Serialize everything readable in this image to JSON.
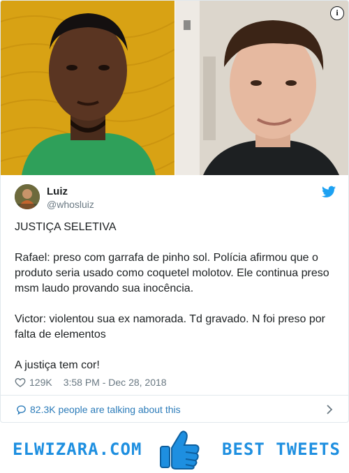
{
  "media": {
    "left_photo_icon": "portrait-photo",
    "right_photo_icon": "portrait-photo",
    "info_label": "i"
  },
  "tweet": {
    "display_name": "Luiz",
    "handle": "@whosluiz",
    "lines": {
      "l1": "JUSTIÇA SELETIVA",
      "l2": "Rafael: preso com garrafa de pinho sol. Polícia afirmou que o",
      "l3": "produto seria usado como coquetel molotov. Ele continua preso",
      "l4": "msm laudo provando sua inocência.",
      "l5": "Victor: violentou sua ex namorada. Td gravado. N foi preso por",
      "l6": "falta de elementos",
      "l7": "A justiça tem cor!"
    },
    "likes": "129K",
    "timestamp": "3:58 PM - Dec 28, 2018",
    "talking": "82.3K people are talking about this"
  },
  "banner": {
    "left": "ELWIZARA.COM",
    "right": "BEST TWEETS",
    "icon": "thumbs-up-icon"
  },
  "colors": {
    "link": "#2b7bb9",
    "twitter_blue": "#1da1f2",
    "banner_blue": "#1e8fe0",
    "muted": "#697882"
  }
}
